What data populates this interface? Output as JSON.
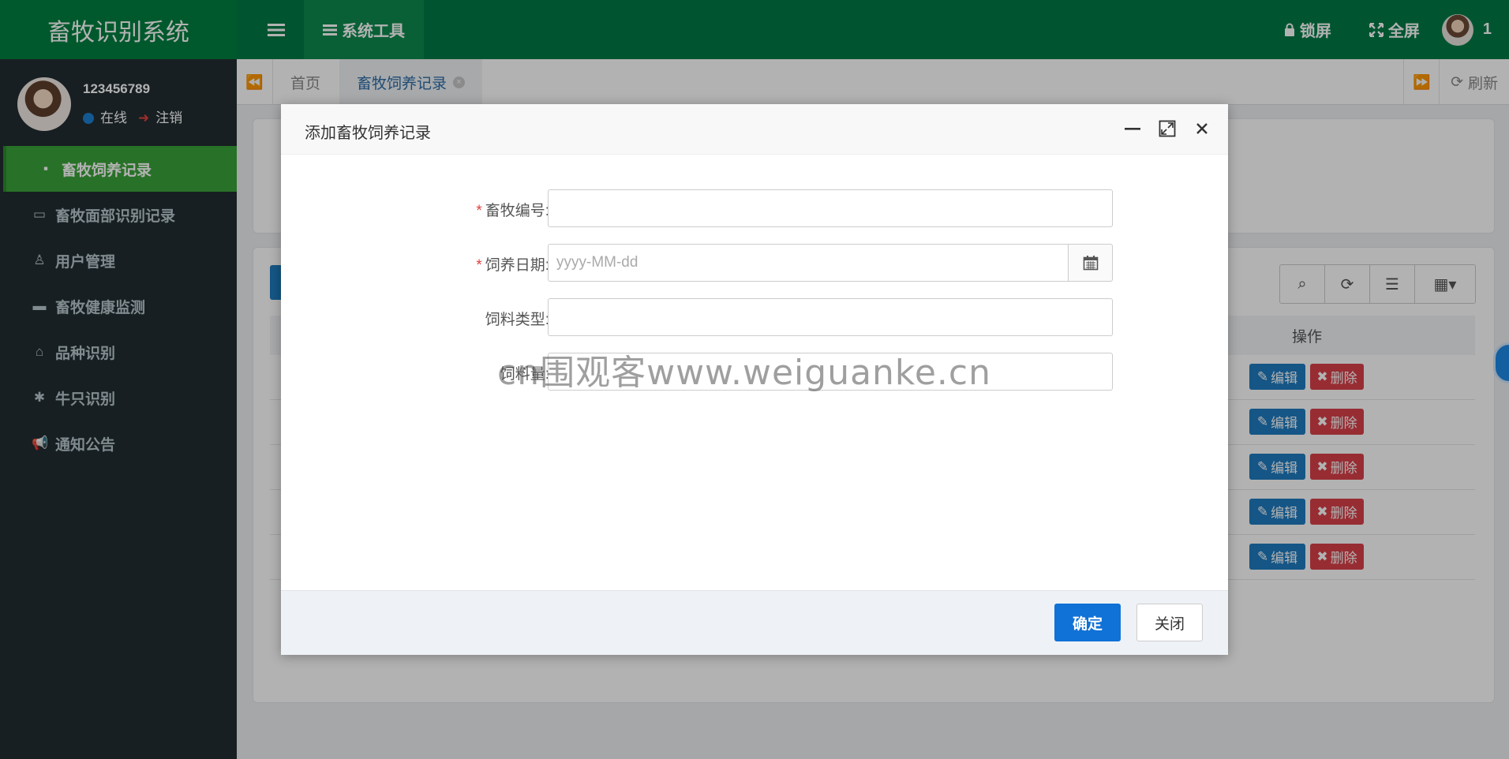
{
  "app": {
    "brand": "畜牧识别系统",
    "sys_tools": "系统工具",
    "lock": "锁屏",
    "fullscreen": "全屏",
    "top_user": "1"
  },
  "user": {
    "name": "123456789",
    "online": "在线",
    "logout": "注销"
  },
  "sidebar": {
    "items": [
      {
        "label": "畜牧饲养记录",
        "icon": "archive-icon"
      },
      {
        "label": "畜牧面部识别记录",
        "icon": "id-card-icon"
      },
      {
        "label": "用户管理",
        "icon": "user-icon"
      },
      {
        "label": "畜牧健康监测",
        "icon": "briefcase-icon"
      },
      {
        "label": "品种识别",
        "icon": "bank-icon"
      },
      {
        "label": "牛只识别",
        "icon": "asterisk-icon"
      },
      {
        "label": "通知公告",
        "icon": "bullhorn-icon"
      }
    ]
  },
  "tabs": {
    "home": "首页",
    "current": "畜牧饲养记录",
    "refresh": "刷新"
  },
  "table": {
    "op_header": "操作",
    "edit_label": "编辑",
    "delete_label": "删除",
    "rows": 5
  },
  "modal": {
    "title": "添加畜牧饲养记录",
    "fields": {
      "livestock_no": {
        "label": "畜牧编号:",
        "required": true,
        "value": ""
      },
      "feed_date": {
        "label": "饲养日期:",
        "required": true,
        "placeholder": "yyyy-MM-dd"
      },
      "feed_type": {
        "label": "饲料类型:",
        "required": false,
        "value": ""
      },
      "feed_amount": {
        "label": "饲料量:",
        "required": false,
        "value": ""
      }
    },
    "ok": "确定",
    "close": "关闭"
  },
  "watermark": "cn围观客www.weiguanke.cn",
  "colors": {
    "topbar": "#007a45",
    "sidebar": "#222d32",
    "active_nav": "#3aa33a",
    "primary": "#1071d6",
    "danger": "#d9414a"
  }
}
